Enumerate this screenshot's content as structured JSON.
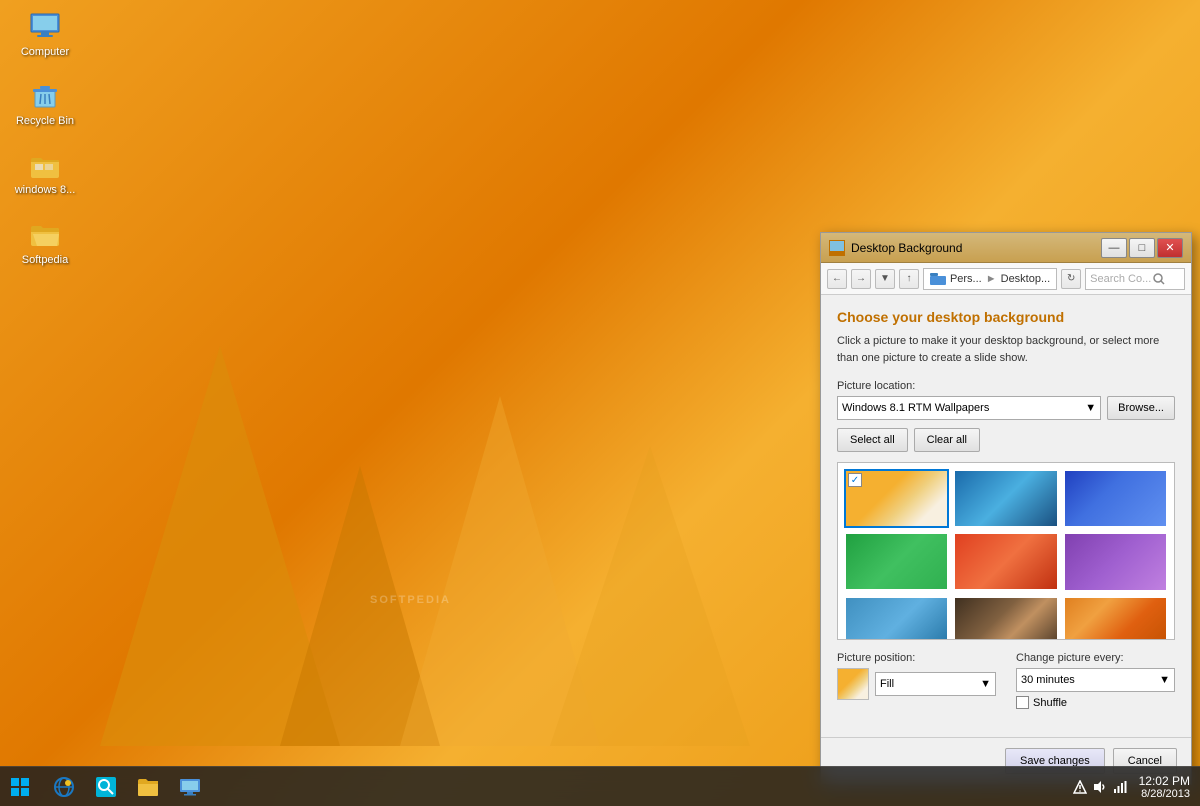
{
  "desktop": {
    "background_color": "#e8920a",
    "watermark": "SOFTPEDIA"
  },
  "desktop_icons": [
    {
      "id": "computer",
      "label": "Computer",
      "type": "computer"
    },
    {
      "id": "recycle",
      "label": "Recycle Bin",
      "type": "recycle"
    },
    {
      "id": "folder",
      "label": "windows 8...",
      "type": "folder"
    },
    {
      "id": "folder2",
      "label": "Softpedia",
      "type": "folder-open"
    }
  ],
  "taskbar": {
    "apps": [
      {
        "id": "ie",
        "label": "Internet Explorer"
      },
      {
        "id": "search",
        "label": "Search"
      },
      {
        "id": "explorer",
        "label": "File Explorer"
      },
      {
        "id": "rdp",
        "label": "Remote Desktop"
      }
    ],
    "time": "12:02 PM",
    "date": "8/28/2013"
  },
  "dialog": {
    "title": "Desktop Background",
    "heading": "Choose your desktop background",
    "description": "Click a picture to make it your desktop background, or select more than one picture to create a slide show.",
    "picture_location_label": "Picture location:",
    "picture_location_value": "Windows 8.1 RTM Wallpapers",
    "browse_label": "Browse...",
    "select_all_label": "Select all",
    "clear_all_label": "Clear all",
    "picture_position_label": "Picture position:",
    "position_value": "Fill",
    "change_every_label": "Change picture every:",
    "change_every_value": "30 minutes",
    "shuffle_label": "Shuffle",
    "save_label": "Save changes",
    "cancel_label": "Cancel",
    "addressbar": {
      "path_parts": [
        "Pers...",
        "Desktop..."
      ],
      "search_placeholder": "Search Co..."
    },
    "wallpapers": [
      {
        "id": "wp1",
        "selected": true,
        "class": "wp1"
      },
      {
        "id": "wp2",
        "selected": false,
        "class": "wp2"
      },
      {
        "id": "wp3",
        "selected": false,
        "class": "wp3"
      },
      {
        "id": "wp4",
        "selected": false,
        "class": "wp4"
      },
      {
        "id": "wp5",
        "selected": false,
        "class": "wp5"
      },
      {
        "id": "wp6",
        "selected": false,
        "class": "wp6"
      },
      {
        "id": "wp7",
        "selected": false,
        "class": "wp7"
      },
      {
        "id": "wp8",
        "selected": false,
        "class": "wp8"
      },
      {
        "id": "wp9",
        "selected": false,
        "class": "wp9"
      }
    ],
    "titlebar_buttons": {
      "minimize": "—",
      "maximize": "□",
      "close": "✕"
    }
  }
}
